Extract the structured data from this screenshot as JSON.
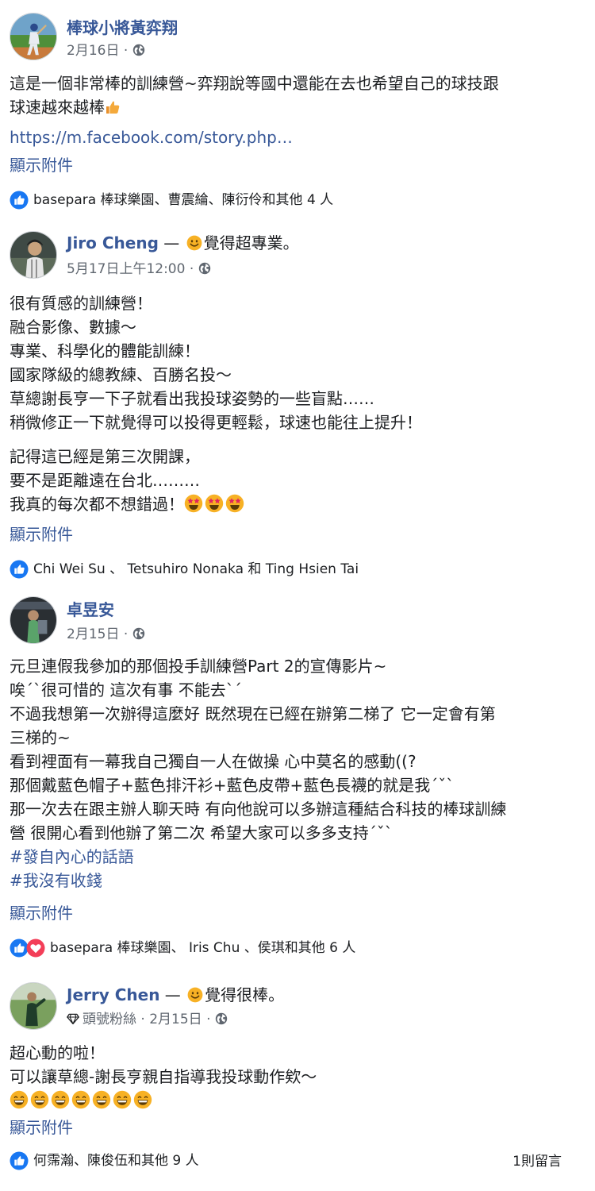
{
  "posts": [
    {
      "author": "棒球小將黃弈翔",
      "feeling": "",
      "badge": "",
      "date": "2月16日",
      "body": [
        "這是一個非常棒的訓練營~弈翔說等國中還能在去也希望自己的球技跟",
        "球速越來越棒"
      ],
      "link": "https://m.facebook.com/story.php…",
      "show_attachments": "顯示附件",
      "reactions": "basepara 棒球樂園、曹震綸、陳衍伶和其他 4 人"
    },
    {
      "author": "Jiro Cheng",
      "feeling": "覺得超專業。",
      "badge": "",
      "date": "5月17日上午12:00",
      "body_p1": [
        "很有質感的訓練營！",
        "融合影像、數據～",
        "專業、科學化的體能訓練！",
        "國家隊級的總教練、百勝名投～",
        "草總謝長亨一下子就看出我投球姿勢的一些盲點……",
        "稍微修正一下就覺得可以投得更輕鬆，球速也能往上提升！"
      ],
      "body_p2": [
        "記得這已經是第三次開課，",
        "要不是距離遠在台北………",
        "我真的每次都不想錯過！"
      ],
      "show_attachments": "顯示附件",
      "reactions": "Chi Wei Su 、 Tetsuhiro Nonaka 和 Ting Hsien Tai"
    },
    {
      "author": "卓昱安",
      "feeling": "",
      "badge": "",
      "date": "2月15日",
      "body": [
        "元旦連假我參加的那個投手訓練營Part 2的宣傳影片~",
        "唉ˊˋ很可惜的 這次有事 不能去ˋˊ",
        "不過我想第一次辦得這麼好 既然現在已經在辦第二梯了 它一定會有第",
        "三梯的~",
        "看到裡面有一幕我自己獨自一人在做操 心中莫名的感動((?",
        "那個戴藍色帽子+藍色排汗衫+藍色皮帶+藍色長襪的就是我ˊˇˋ",
        "那一次去在跟主辦人聊天時 有向他說可以多辦這種結合科技的棒球訓練",
        "營 很開心看到他辦了第二次 希望大家可以多多支持ˊˇˋ"
      ],
      "hashtags": [
        "#發自內心的話語",
        "#我沒有收錢"
      ],
      "show_attachments": "顯示附件",
      "reactions": "basepara 棒球樂園、 Iris Chu 、侯琪和其他 6 人"
    },
    {
      "author": "Jerry Chen",
      "feeling": "覺得很棒。",
      "badge": "頭號粉絲",
      "date": "2月15日",
      "body": [
        "超心動的啦！",
        "可以讓草總-謝長亨親自指導我投球動作欸～"
      ],
      "show_attachments": "顯示附件",
      "reactions": "何霈瀚、陳俊伍和其他 9 人",
      "comments": "1則留言"
    }
  ],
  "separators": {
    "meta": " · ",
    "author_feeling": " — "
  },
  "icons": {
    "globe": "globe-icon",
    "like": "like-icon",
    "love": "love-icon",
    "thumbs_up": "thumbs-up-emoji",
    "star_struck": "star-struck-emoji",
    "grin": "grinning-emoji",
    "smile": "smile-emoji",
    "diamond": "diamond-icon"
  },
  "colors": {
    "link": "#385898",
    "meta": "#606770",
    "like_blue": "#1877f2",
    "love_red": "#f33e58"
  }
}
